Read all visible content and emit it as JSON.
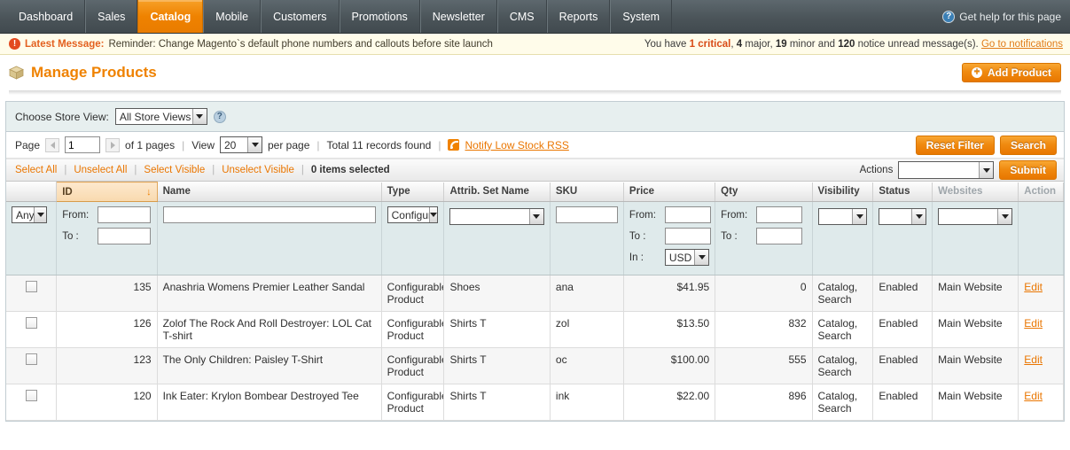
{
  "topnav": {
    "items": [
      {
        "label": "Dashboard",
        "active": false
      },
      {
        "label": "Sales",
        "active": false
      },
      {
        "label": "Catalog",
        "active": true
      },
      {
        "label": "Mobile",
        "active": false
      },
      {
        "label": "Customers",
        "active": false
      },
      {
        "label": "Promotions",
        "active": false
      },
      {
        "label": "Newsletter",
        "active": false
      },
      {
        "label": "CMS",
        "active": false
      },
      {
        "label": "Reports",
        "active": false
      },
      {
        "label": "System",
        "active": false
      }
    ],
    "help_label": "Get help for this page",
    "help_icon": "question-mark-circle-icon",
    "active_color": "#ef8200",
    "bg_color": "#4b5459"
  },
  "message_bar": {
    "icon": "exclamation-circle-icon",
    "label": "Latest Message:",
    "text": "Reminder: Change Magento`s default phone numbers and callouts before site launch",
    "summary_prefix": "You have ",
    "critical_count": "1",
    "critical_word": "critical",
    "major_count": "4",
    "major_word": "major",
    "minor_count": "19",
    "minor_word": "minor",
    "notice_count": "120",
    "notice_word": "notice unread message(s).",
    "sep_comma": ", ",
    "sep_and": " and ",
    "link": "Go to notifications"
  },
  "page_head": {
    "icon": "box-icon",
    "title": "Manage Products",
    "add_button": "Add Product",
    "add_button_icon": "plus-circle-icon"
  },
  "store_view": {
    "label": "Choose Store View:",
    "selected": "All Store Views",
    "help_icon": "question-mark-circle-icon"
  },
  "pager": {
    "page_label": "Page",
    "prev_icon": "chevron-left-icon",
    "next_icon": "chevron-right-icon",
    "page_value": "1",
    "of_pages": "of 1 pages",
    "view_label": "View",
    "per_page_value": "20",
    "per_page_label": "per page",
    "total_records": "Total 11 records found",
    "rss_icon": "rss-icon",
    "rss_link": "Notify Low Stock RSS",
    "reset_filter": "Reset Filter",
    "search": "Search"
  },
  "selection_bar": {
    "select_all": "Select All",
    "unselect_all": "Unselect All",
    "select_visible": "Select Visible",
    "unselect_visible": "Unselect Visible",
    "items_selected": "0 items selected",
    "actions_label": "Actions",
    "actions_value": "",
    "submit": "Submit"
  },
  "grid": {
    "columns": [
      {
        "key": "checkbox",
        "label": "",
        "sorted": false
      },
      {
        "key": "id",
        "label": "ID",
        "sorted": true,
        "sort_dir": "↓"
      },
      {
        "key": "name",
        "label": "Name",
        "sorted": false
      },
      {
        "key": "type",
        "label": "Type",
        "sorted": false
      },
      {
        "key": "attrib_set",
        "label": "Attrib. Set Name",
        "sorted": false
      },
      {
        "key": "sku",
        "label": "SKU",
        "sorted": false
      },
      {
        "key": "price",
        "label": "Price",
        "sorted": false
      },
      {
        "key": "qty",
        "label": "Qty",
        "sorted": false
      },
      {
        "key": "visibility",
        "label": "Visibility",
        "sorted": false
      },
      {
        "key": "status",
        "label": "Status",
        "sorted": false
      },
      {
        "key": "websites",
        "label": "Websites",
        "sorted": false,
        "muted": true
      },
      {
        "key": "action",
        "label": "Action",
        "sorted": false,
        "muted": true
      }
    ],
    "filters": {
      "checkbox_select": "Any",
      "id_from_label": "From:",
      "id_to_label": "To :",
      "id_from": "",
      "id_to": "",
      "name": "",
      "type": "Configurable Product",
      "attrib_set": "",
      "sku": "",
      "price_from_label": "From:",
      "price_to_label": "To :",
      "price_in_label": "In :",
      "price_from": "",
      "price_to": "",
      "price_currency": "USD",
      "qty_from_label": "From:",
      "qty_to_label": "To :",
      "qty_from": "",
      "qty_to": "",
      "visibility": "",
      "status": "",
      "websites": ""
    },
    "rows": [
      {
        "id": "135",
        "name": "Anashria Womens Premier Leather Sandal",
        "type": "Configurable Product",
        "attrib_set": "Shoes",
        "sku": "ana",
        "price": "$41.95",
        "qty": "0",
        "visibility": "Catalog, Search",
        "status": "Enabled",
        "websites": "Main Website",
        "action": "Edit"
      },
      {
        "id": "126",
        "name": "Zolof The Rock And Roll Destroyer: LOL Cat T-shirt",
        "type": "Configurable Product",
        "attrib_set": "Shirts T",
        "sku": "zol",
        "price": "$13.50",
        "qty": "832",
        "visibility": "Catalog, Search",
        "status": "Enabled",
        "websites": "Main Website",
        "action": "Edit"
      },
      {
        "id": "123",
        "name": "The Only Children: Paisley T-Shirt",
        "type": "Configurable Product",
        "attrib_set": "Shirts T",
        "sku": "oc",
        "price": "$100.00",
        "qty": "555",
        "visibility": "Catalog, Search",
        "status": "Enabled",
        "websites": "Main Website",
        "action": "Edit"
      },
      {
        "id": "120",
        "name": "Ink Eater: Krylon Bombear Destroyed Tee",
        "type": "Configurable Product",
        "attrib_set": "Shirts T",
        "sku": "ink",
        "price": "$22.00",
        "qty": "896",
        "visibility": "Catalog, Search",
        "status": "Enabled",
        "websites": "Main Website",
        "action": "Edit"
      }
    ]
  }
}
